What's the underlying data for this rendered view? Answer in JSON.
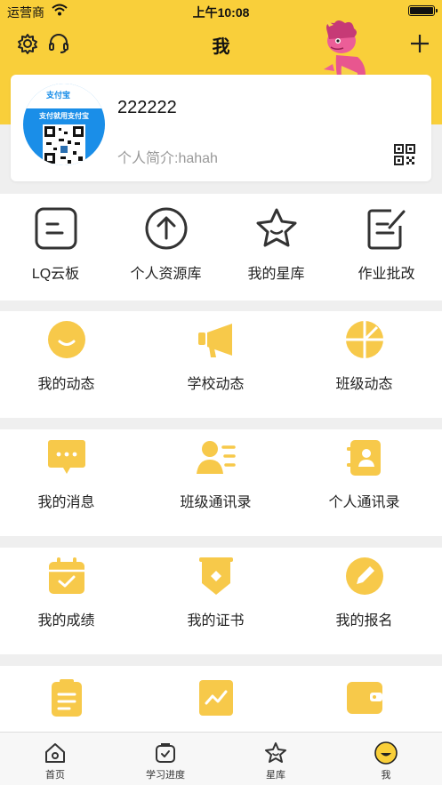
{
  "status": {
    "carrier": "运营商",
    "time": "上午10:08"
  },
  "header": {
    "title": "我"
  },
  "profile": {
    "username": "222222",
    "bio": "个人简介:hahah",
    "avatar_logo": "支付宝",
    "avatar_caption": "支付就用支付宝"
  },
  "tools": [
    {
      "label": "LQ云板"
    },
    {
      "label": "个人资源库"
    },
    {
      "label": "我的星库"
    },
    {
      "label": "作业批改"
    }
  ],
  "row1": [
    {
      "label": "我的动态"
    },
    {
      "label": "学校动态"
    },
    {
      "label": "班级动态"
    }
  ],
  "row2": [
    {
      "label": "我的消息"
    },
    {
      "label": "班级通讯录"
    },
    {
      "label": "个人通讯录"
    }
  ],
  "row3": [
    {
      "label": "我的成绩"
    },
    {
      "label": "我的证书"
    },
    {
      "label": "我的报名"
    }
  ],
  "tabbar": [
    {
      "label": "首页"
    },
    {
      "label": "学习进度"
    },
    {
      "label": "星库"
    },
    {
      "label": "我"
    }
  ],
  "colors": {
    "accent": "#f9cf3a",
    "icon_yellow": "#f7c94a",
    "text": "#222222"
  }
}
